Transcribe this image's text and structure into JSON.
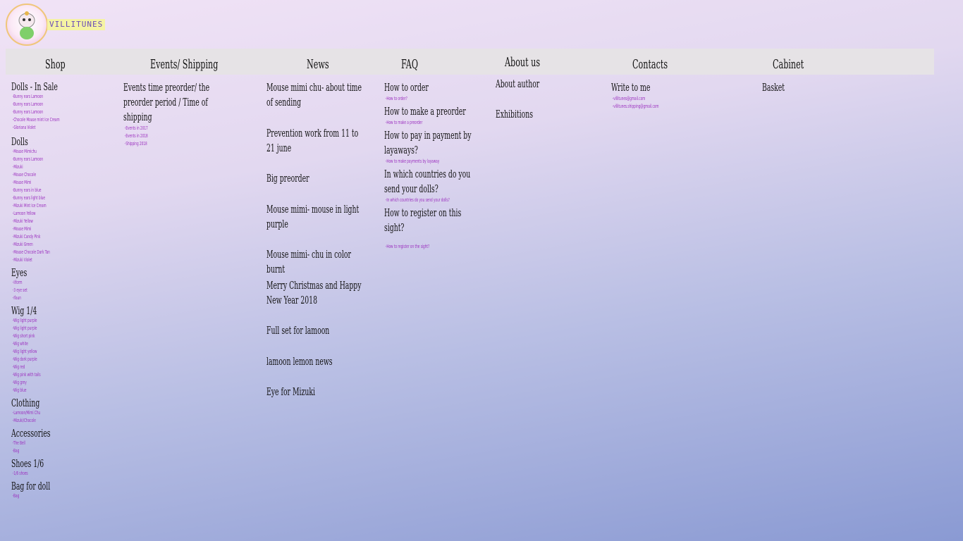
{
  "logo": {
    "text": "VILLITUNES"
  },
  "nav": [
    "Shop",
    "Events/ Shipping",
    "News",
    "FAQ",
    "About us",
    "Contacts",
    "Cabinet"
  ],
  "shop": [
    {
      "title": "Dolls - In Sale",
      "items": [
        "-Bunny ears Lamoon",
        "-Bunny ears Lamoon",
        "-Bunny ears Lamoon",
        "-Chocole Mouse mint Ice Cream",
        "-Gloriana Violet"
      ]
    },
    {
      "title": "Dolls",
      "items": [
        "-Mouse Mimichu",
        "-Bunny ears Lamoon",
        "-Mizuki",
        "-Mouse Chocole",
        "-Mouse Mimi",
        "-Bunny ears in blue",
        "-Bunny ears light blue",
        "-Mizuki Mint Ice Cream",
        "-Lamoon Yellow",
        "-Mizuki Yellow",
        "-Mouse Mimi",
        "-Mizuki Candy Pink",
        "-Mizuki Green",
        "-Mouse Chocole Dark Tan",
        "-Mizuki Violet"
      ]
    },
    {
      "title": "Eyes",
      "items": [
        "-Iiform",
        "-3 eye set",
        "-Ifaun"
      ]
    },
    {
      "title": "Wig 1/4",
      "items": [
        "-Wig light purple",
        "-Wig light purple",
        "-Wig short pink",
        "-Wig white",
        "-Wig light yellow",
        "-Wig dark purple",
        "-Wig red",
        "-Wig pink with tails",
        "-Wig grey",
        "-Wig blue"
      ]
    },
    {
      "title": "Clothing",
      "items": [
        "-Lamoon/Mimi Chu",
        "-Mizuki/Chocole"
      ]
    },
    {
      "title": "Accessories",
      "items": [
        "-The Bell",
        "-Bag"
      ]
    },
    {
      "title": "Shoes 1/6",
      "items": [
        "-1/6 shoes"
      ]
    },
    {
      "title": "Bag for doll",
      "items": [
        "-Bag"
      ]
    }
  ],
  "events": {
    "title": "Events time preorder/ the preorder period / Time of shipping",
    "items": [
      "-Events in 2017",
      "-Events in 2018",
      "-Shipping 2018"
    ]
  },
  "news": [
    "Mouse mimi chu- about time of sending",
    "Prevention work from 11 to 21 june",
    "Big preorder",
    "Mouse mimi- mouse in light purple",
    "Mouse mimi- chu in color burnt",
    "Merry Christmas and Happy New Year 2018",
    "Full set for lamoon",
    "lamoon lemon news",
    "Eye for Mizuki"
  ],
  "faq": [
    {
      "title": "How to order",
      "sub": "-How to order?"
    },
    {
      "title": "How to make a preorder",
      "sub": "-How to make a preorder"
    },
    {
      "title": "How to pay in payment by layaways?",
      "sub": "-How to make payments by layaway"
    },
    {
      "title": "In which countries do you send your dolls?",
      "sub": "-In which countries do you send your dolls?"
    },
    {
      "title": "How to register on this sight?",
      "sub": "-How to register on the sight?"
    }
  ],
  "about": [
    "About author",
    "Exhibitions"
  ],
  "contacts": {
    "title": "Write to me",
    "items": [
      "-villitunes@gmail.com",
      "-villitunes.shipping@gmail.com"
    ]
  },
  "cabinet": {
    "title": "Basket"
  }
}
